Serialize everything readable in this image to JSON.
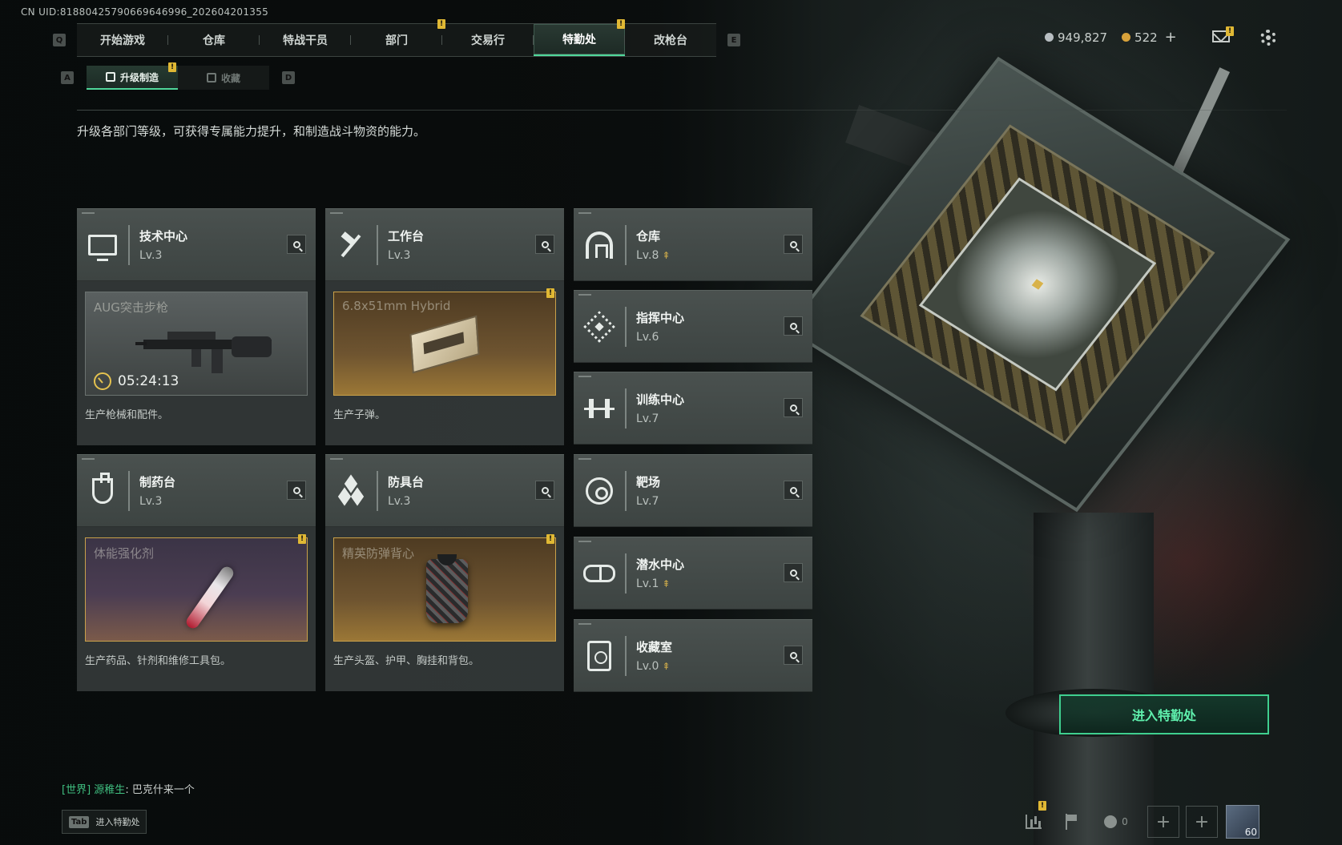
{
  "uid": "CN UID:81880425790669646996_202604201355",
  "topnav": {
    "key_left": "Q",
    "key_right": "E",
    "tabs": [
      {
        "label": "开始游戏",
        "active": false,
        "badge": ""
      },
      {
        "label": "仓库",
        "active": false,
        "badge": ""
      },
      {
        "label": "特战干员",
        "active": false,
        "badge": ""
      },
      {
        "label": "部门",
        "active": false,
        "badge": "!"
      },
      {
        "label": "交易行",
        "active": false,
        "badge": ""
      },
      {
        "label": "特勤处",
        "active": true,
        "badge": "!"
      },
      {
        "label": "改枪台",
        "active": false,
        "badge": ""
      }
    ]
  },
  "currency": {
    "silver": "949,827",
    "gold": "522",
    "plus": "+",
    "silver_color": "#b8bec2",
    "gold_color": "#d8a23a"
  },
  "icons": {
    "mail": "mail-icon",
    "settings": "gear-icon"
  },
  "subnav": {
    "key_left": "A",
    "key_right": "D",
    "tabs": [
      {
        "label": "升级制造",
        "active": true
      },
      {
        "label": "收藏",
        "active": false
      }
    ]
  },
  "description": "升级各部门等级，可获得专属能力提升，和制造战斗物资的能力。",
  "facilities": {
    "tech": {
      "name": "技术中心",
      "level": "Lv.3",
      "product": "AUG突击步枪",
      "timer": "05:24:13",
      "desc": "生产枪械和配件。"
    },
    "workbench": {
      "name": "工作台",
      "level": "Lv.3",
      "product": "6.8x51mm Hybrid",
      "desc": "生产子弹。"
    },
    "pharmacy": {
      "name": "制药台",
      "level": "Lv.3",
      "product": "体能强化剂",
      "desc": "生产药品、针剂和维修工具包。"
    },
    "armor": {
      "name": "防具台",
      "level": "Lv.3",
      "product": "精英防弹背心",
      "desc": "生产头盔、护甲、胸挂和背包。"
    },
    "warehouse": {
      "name": "仓库",
      "level": "Lv.8"
    },
    "command": {
      "name": "指挥中心",
      "level": "Lv.6"
    },
    "training": {
      "name": "训练中心",
      "level": "Lv.7"
    },
    "range": {
      "name": "靶场",
      "level": "Lv.7"
    },
    "diving": {
      "name": "潜水中心",
      "level": "Lv.1"
    },
    "collection": {
      "name": "收藏室",
      "level": "Lv.0"
    }
  },
  "upgrade_arrow": "⇞",
  "badge_mark": "!",
  "enter_button": "进入特勤处",
  "chat": {
    "channel": "[世界]",
    "sender": "源稚生",
    "message": "巴克什来一个"
  },
  "tab_hint": {
    "key": "Tab",
    "label": "进入特勤处"
  },
  "bottombar": {
    "friends_count": "0",
    "avatar_level": "60",
    "plus": "+"
  },
  "accent_color": "#4fd79a",
  "badge_color": "#e0b834"
}
